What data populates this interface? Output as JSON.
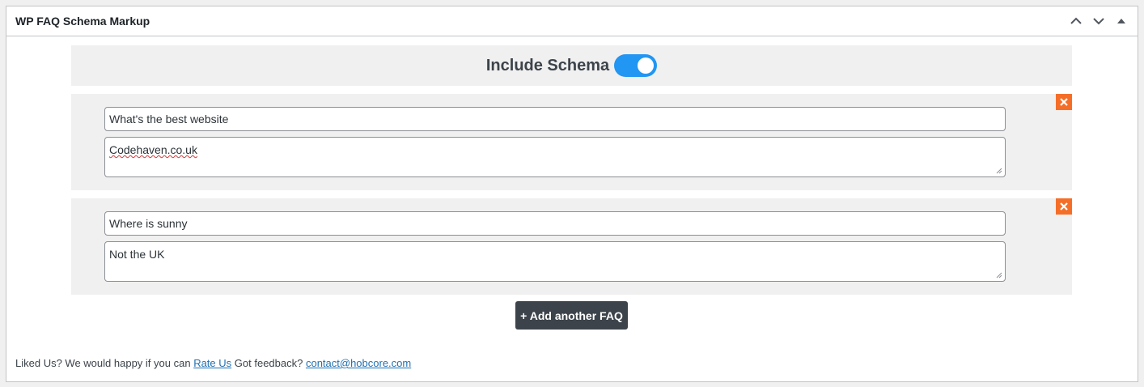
{
  "metabox": {
    "title": "WP FAQ Schema Markup",
    "controls": {
      "move_up_icon": "chevron-up-icon",
      "move_down_icon": "chevron-down-icon",
      "toggle_panel_icon": "triangle-up-icon"
    }
  },
  "schema": {
    "label": "Include Schema",
    "enabled": true,
    "toggle_color": "#2196f3"
  },
  "faqs": [
    {
      "question": "What's the best website",
      "answer": "Codehaven.co.uk"
    },
    {
      "question": "Where is sunny",
      "answer": "Not the UK"
    }
  ],
  "remove_color": "#f56e28",
  "add_button_label": "+ Add another FAQ",
  "footer": {
    "text_before": "Liked Us? We would happy if you can",
    "rate_link": "Rate Us",
    "text_middle": "Got feedback?",
    "contact_link": "contact@hobcore.com"
  }
}
